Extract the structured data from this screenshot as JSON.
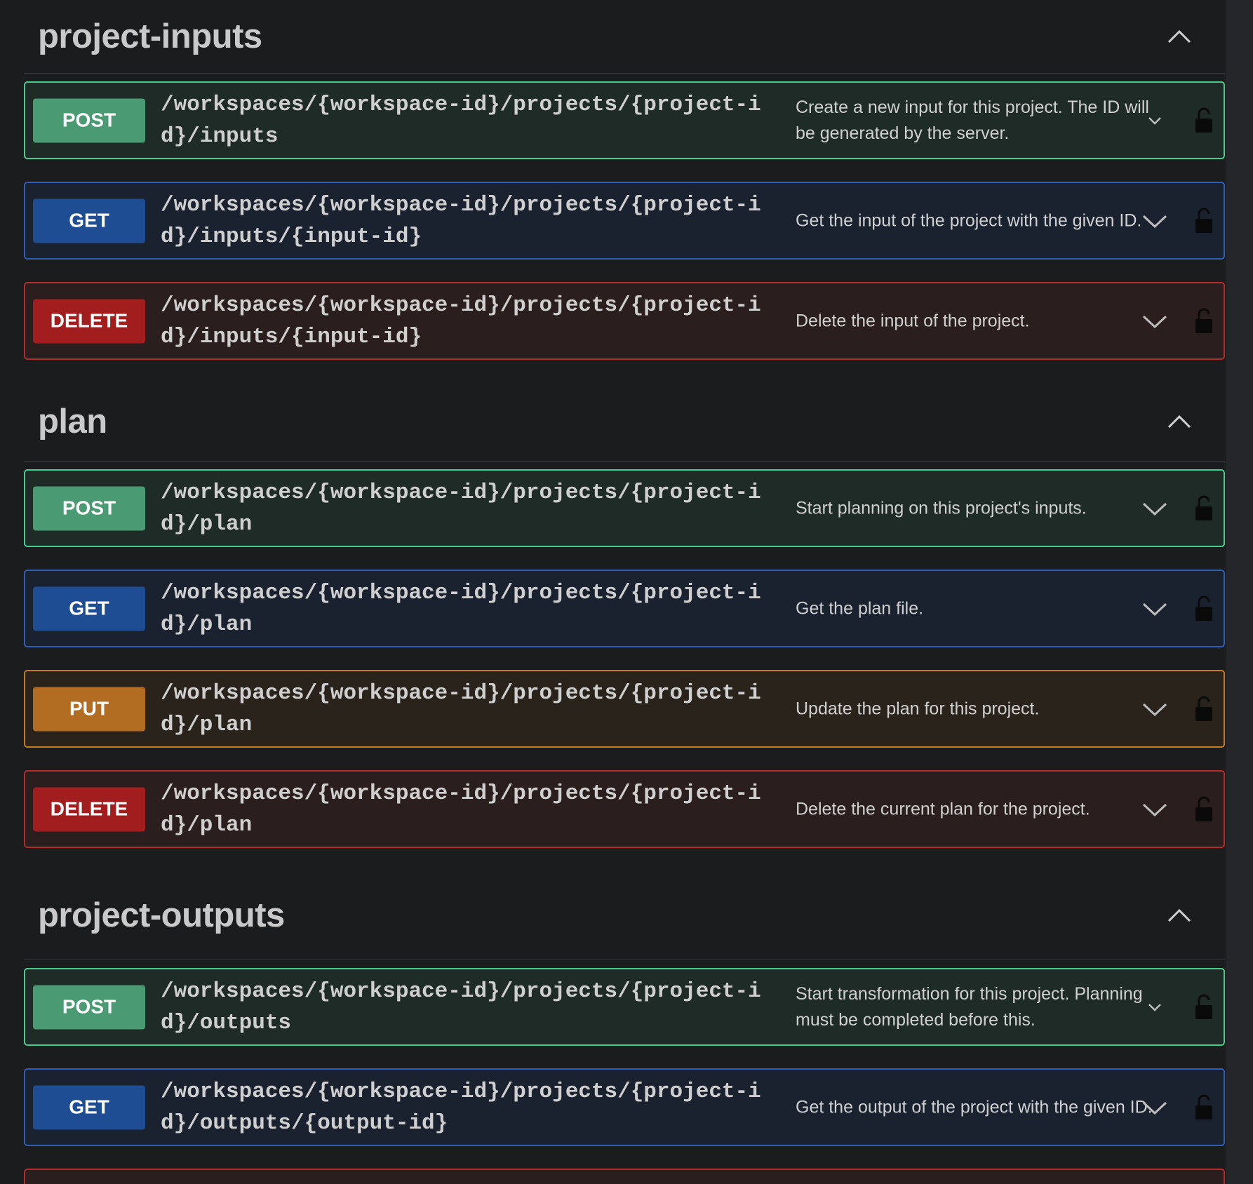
{
  "sections": [
    {
      "title": "project-inputs",
      "operations": [
        {
          "method": "POST",
          "path": "/workspaces/{workspace-id}/projects/{project-id}/inputs",
          "summary": "Create a new input for this project. The ID will be generated by the server."
        },
        {
          "method": "GET",
          "path": "/workspaces/{workspace-id}/projects/{project-id}/inputs/{input-id}",
          "summary": "Get the input of the project with the given ID."
        },
        {
          "method": "DELETE",
          "path": "/workspaces/{workspace-id}/projects/{project-id}/inputs/{input-id}",
          "summary": "Delete the input of the project."
        }
      ]
    },
    {
      "title": "plan",
      "operations": [
        {
          "method": "POST",
          "path": "/workspaces/{workspace-id}/projects/{project-id}/plan",
          "summary": "Start planning on this project's inputs."
        },
        {
          "method": "GET",
          "path": "/workspaces/{workspace-id}/projects/{project-id}/plan",
          "summary": "Get the plan file."
        },
        {
          "method": "PUT",
          "path": "/workspaces/{workspace-id}/projects/{project-id}/plan",
          "summary": "Update the plan for this project."
        },
        {
          "method": "DELETE",
          "path": "/workspaces/{workspace-id}/projects/{project-id}/plan",
          "summary": "Delete the current plan for the project."
        }
      ]
    },
    {
      "title": "project-outputs",
      "operations": [
        {
          "method": "POST",
          "path": "/workspaces/{workspace-id}/projects/{project-id}/outputs",
          "summary": "Start transformation for this project. Planning must be completed before this."
        },
        {
          "method": "GET",
          "path": "/workspaces/{workspace-id}/projects/{project-id}/outputs/{output-id}",
          "summary": "Get the output of the project with the given ID."
        }
      ]
    }
  ],
  "colors": {
    "post": "#49cc90",
    "get": "#2f5fb4",
    "delete": "#b52a2a",
    "put": "#c27d23",
    "background": "#1b1c1e"
  },
  "icons": {
    "section_toggle": "chevron-up-icon",
    "operation_expand": "chevron-down-icon",
    "auth": "lock-icon"
  }
}
